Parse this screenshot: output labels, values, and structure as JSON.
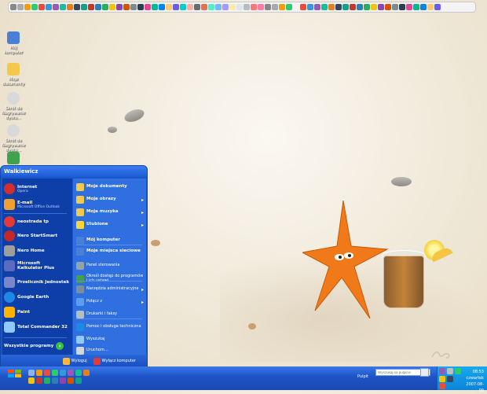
{
  "user": {
    "name": "Walkiewicz"
  },
  "desktop_icons": [
    {
      "label": "Mój komputer",
      "color": "#4a7fd6"
    },
    {
      "label": "Moje dokumenty",
      "color": "#f2c94c"
    },
    {
      "label": "Skrót do Nagrywanie dysku…",
      "color": "#d9d9d9"
    },
    {
      "label": "Skrót do Nagrywanie dysku…",
      "color": "#d9d9d9"
    },
    {
      "label": "",
      "color": "#3fa34d"
    }
  ],
  "start_menu": {
    "pinned": [
      {
        "title": "Internet",
        "subtitle": "Opera",
        "color": "#d32f2f"
      },
      {
        "title": "E-mail",
        "subtitle": "Microsoft Office Outlook",
        "color": "#f0a030"
      }
    ],
    "recent": [
      {
        "title": "neostrada tp",
        "color": "#e53935"
      },
      {
        "title": "Nero StartSmart",
        "color": "#c62828"
      },
      {
        "title": "Nero Home",
        "color": "#9e9e9e"
      },
      {
        "title": "Microsoft Kalkulator Plus",
        "color": "#5c6bc0"
      },
      {
        "title": "Przelicznik Jednostek",
        "color": "#7986cb"
      },
      {
        "title": "Google Earth",
        "color": "#1e88e5"
      },
      {
        "title": "Paint",
        "color": "#ffb300"
      },
      {
        "title": "Total Commander 32",
        "color": "#90caf9"
      }
    ],
    "all_programs": "Wszystkie programy",
    "right": [
      {
        "label": "Moje dokumenty",
        "bold": true,
        "arrow": false,
        "color": "#f2c94c"
      },
      {
        "label": "Moje obrazy",
        "bold": true,
        "arrow": true,
        "color": "#f2c94c"
      },
      {
        "label": "Moja muzyka",
        "bold": true,
        "arrow": true,
        "color": "#f2c94c"
      },
      {
        "label": "Ulubione",
        "bold": true,
        "arrow": true,
        "color": "#fdd835"
      },
      {
        "label": "Mój komputer",
        "bold": true,
        "arrow": false,
        "color": "#4a7fd6"
      },
      {
        "label": "Moje miejsca sieciowe",
        "bold": true,
        "arrow": false,
        "color": "#4a7fd6"
      },
      {
        "label": "Panel sterowania",
        "bold": false,
        "arrow": false,
        "color": "#90a4ae"
      },
      {
        "label": "Określ dostęp do programów i ich ustawi…",
        "bold": false,
        "arrow": false,
        "color": "#43a047"
      },
      {
        "label": "Narzędzia administracyjne",
        "bold": false,
        "arrow": true,
        "color": "#78909c"
      },
      {
        "label": "Połącz z",
        "bold": false,
        "arrow": true,
        "color": "#5c9ded"
      },
      {
        "label": "Drukarki i faksy",
        "bold": false,
        "arrow": false,
        "color": "#b0bec5"
      },
      {
        "label": "Pomoc i obsługa techniczna",
        "bold": false,
        "arrow": false,
        "color": "#1e88e5"
      },
      {
        "label": "Wyszukaj",
        "bold": false,
        "arrow": false,
        "color": "#90caf9"
      },
      {
        "label": "Uruchom…",
        "bold": false,
        "arrow": false,
        "color": "#cfd8dc"
      }
    ],
    "footer": {
      "logoff": "Wyloguj",
      "shutdown": "Wyłącz komputer"
    }
  },
  "taskbar": {
    "desktop_label": "Pulpit",
    "search_placeholder": "Wyszukaj na pulpicie",
    "time": "08:53",
    "day": "czwartek",
    "date": "2007-08-09"
  },
  "colors": {
    "taskbar": "#1e56c8",
    "start_menu_left": "#0e3fa8",
    "start_menu_right": "#2f6fe0",
    "starfish": "#f07a1a"
  }
}
